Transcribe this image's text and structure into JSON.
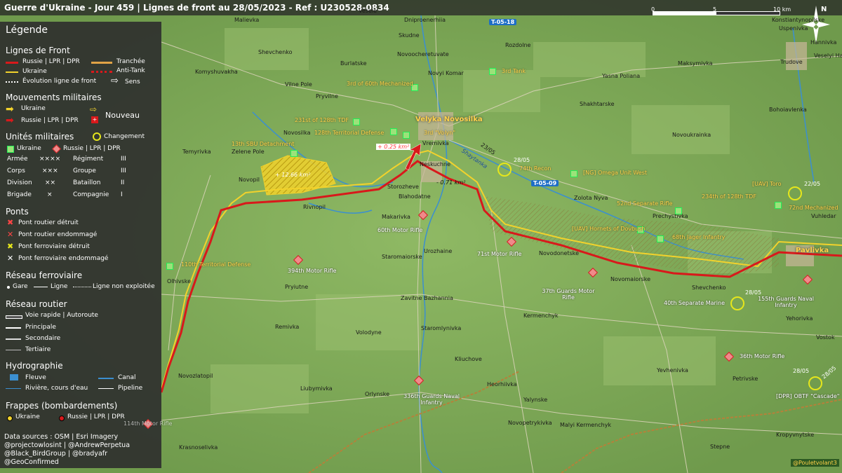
{
  "header": {
    "title": "Guerre d'Ukraine - Jour 459 | Lignes de front au 28/05/2023 - Ref : U230528-0834",
    "scale_labels": [
      "0",
      "5",
      "10 km"
    ],
    "north": "N"
  },
  "legend": {
    "title": "Légende",
    "front_title": "Lignes de Front",
    "front_items": [
      "Russie | LPR | DPR",
      "Ukraine",
      "Évolution ligne de front",
      "Tranchée",
      "Anti-Tank",
      "Sens"
    ],
    "moves_title": "Mouvements militaires",
    "moves_items": [
      "Ukraine",
      "Russie | LPR | DPR",
      "Nouveau"
    ],
    "units_title": "Unités militaires",
    "units_change": "Changement",
    "units_sides": [
      "Ukraine",
      "Russie | LPR | DPR"
    ],
    "units_sizes": [
      {
        "name": "Armée",
        "sym": "××××"
      },
      {
        "name": "Corps",
        "sym": "×××"
      },
      {
        "name": "Division",
        "sym": "××"
      },
      {
        "name": "Brigade",
        "sym": "×"
      },
      {
        "name": "Régiment",
        "sym": "III"
      },
      {
        "name": "Groupe",
        "sym": "III"
      },
      {
        "name": "Bataillon",
        "sym": "II"
      },
      {
        "name": "Compagnie",
        "sym": "I"
      }
    ],
    "bridges_title": "Ponts",
    "bridges_items": [
      "Pont routier détruit",
      "Pont routier endommagé",
      "Pont ferroviaire détruit",
      "Pont ferroviaire endommagé"
    ],
    "rail_title": "Réseau ferroviaire",
    "rail_items": [
      "Gare",
      "Ligne",
      "Ligne non exploitée"
    ],
    "road_title": "Réseau routier",
    "road_items": [
      "Voie rapide | Autoroute",
      "Principale",
      "Secondaire",
      "Tertiaire"
    ],
    "hydro_title": "Hydrographie",
    "hydro_items": [
      "Fleuve",
      "Canal",
      "Rivière, cours d'eau",
      "Pipeline"
    ],
    "strikes_title": "Frappes (bombardements)",
    "strikes_items": [
      "Ukraine",
      "Russie | LPR | DPR"
    ],
    "sources": [
      "Data sources : OSM | Esri Imagery",
      "@projectowlosint | @AndrewPerpetua",
      "@Black_BirdGroup | @bradyafr",
      "@GeoConfirmed"
    ]
  },
  "colors": {
    "russia": "#d8191b",
    "ukraine": "#f2d22c",
    "trench": "#e0a346",
    "map": "#7da65a"
  },
  "map": {
    "city": "Velyka Novosilka",
    "city2": "Pavlivka",
    "roads": [
      "T-05-18",
      "T-05-09"
    ],
    "river": "Shaytanka",
    "road_number": "23/05",
    "areas": [
      "+ 12.66 km²",
      "+ 0.25 km²",
      "- 0.71 km²"
    ],
    "villages": [
      "Malievka",
      "Vesele",
      "Dniproenerhiia",
      "Skudne",
      "Rozdolne",
      "Konstiantynopilske",
      "Uspenivka",
      "Hannivka",
      "Veselyi Hai",
      "Shevchenko",
      "Novoocheretuvate",
      "Trudove",
      "Komyshuvakha",
      "Burlatske",
      "Novyi Komar",
      "Yasna Poliana",
      "Maksymivka",
      "Vilne Pole",
      "Pryvilne",
      "Shakhtarske",
      "Bohoiavlenka",
      "Novosilka",
      "Vremivka",
      "Novoukrainka",
      "Temyrivka",
      "Zelene Pole",
      "Neskuchne",
      "Novopil",
      "Storozheve",
      "Zolota Nyva",
      "Rivnopil",
      "Blahodatne",
      "Prechystivka",
      "Vuhledar",
      "Makarivka",
      "Urozhaine",
      "Novodonetske",
      "Staromaiorske",
      "Olhivske",
      "Novomaiorske",
      "Pryiutne",
      "Shevchenko",
      "Zavitne Bazhannia",
      "Kermenchyk",
      "Yehorivka",
      "Remivka",
      "Staromlynivka",
      "Vostok",
      "Volodyne",
      "Novozlatopil",
      "Kliuchove",
      "Yevhenivka",
      "Liubymivka",
      "Orlynske",
      "Heorhiivka",
      "Petrivske",
      "Yalynske",
      "Malyi Kermenchyk",
      "Novopetrykivka",
      "Krasnoselivka",
      "Stepne",
      "Kropyvnytske"
    ],
    "ua_units": [
      "3rd Tank",
      "3rd of 60th Mechanized",
      "231st of 128th TDF",
      "128th Territorial Defense",
      "13th SBU Detachment",
      "3rd \"Volyn\"",
      "74th Recon",
      "[NG] Omega Unit West",
      "52nd Separate Rifle",
      "[UAV] Toro",
      "234th of 128th TDF",
      "72nd Mechanized",
      "[UAV] Hornets of Dovbush",
      "68th Jager Infantry",
      "110th Territorial Defense"
    ],
    "ru_units": [
      "60th Motor Rifle",
      "71st Motor Rifle",
      "394th Motor Rifle",
      "37th Guards Motor Rifle",
      "40th Separate Marine",
      "155th Guards Naval Infantry",
      "36th Motor Rifle",
      "336th Guards Naval Infantry",
      "[DPR] OBTF \"Cascade\"",
      "114th Motor Rifle"
    ],
    "dates": [
      "28/05",
      "22/05",
      "28/05",
      "28/05",
      "28/05"
    ],
    "credit": "@Pouletvolant3"
  }
}
